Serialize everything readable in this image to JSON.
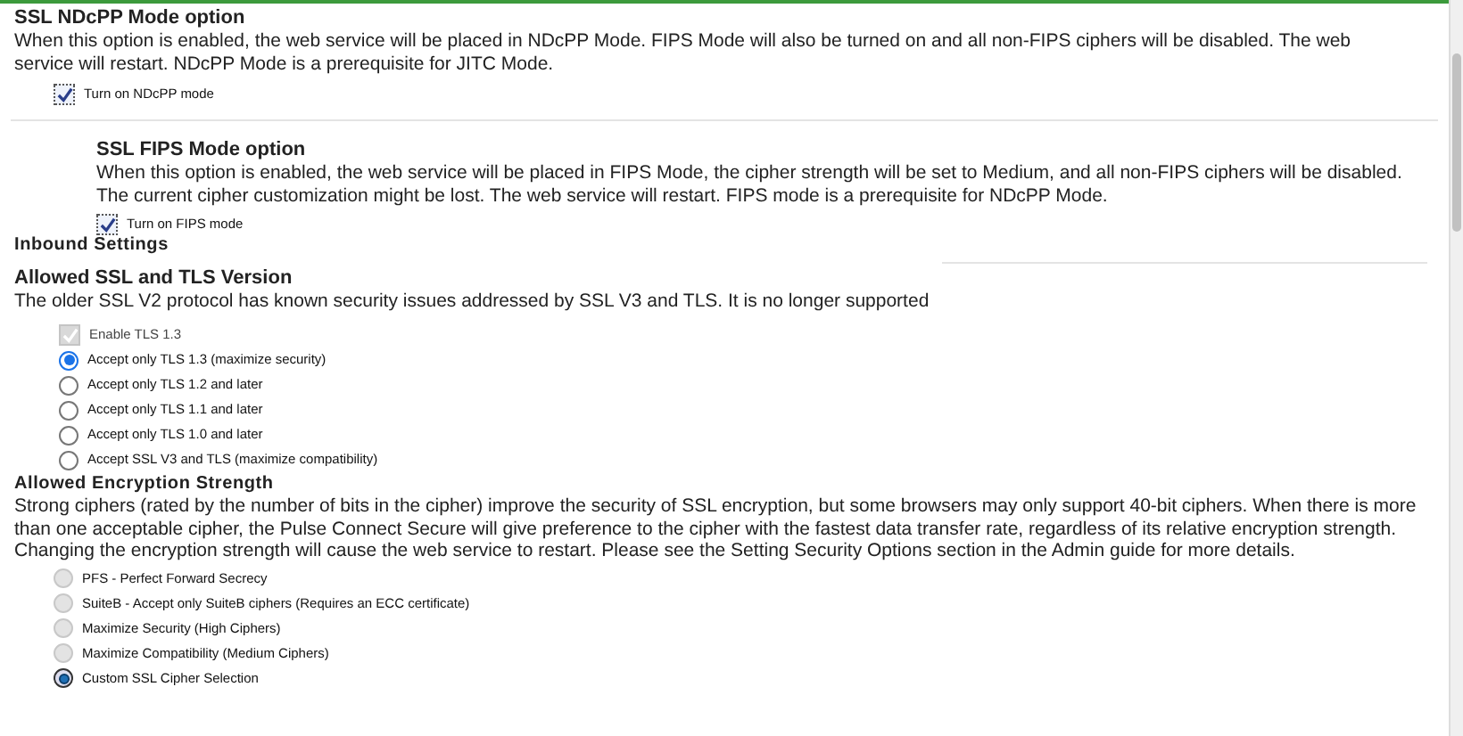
{
  "ndcpp": {
    "title": "SSL NDcPP Mode option",
    "description": "When this option is enabled, the web service will be placed in NDcPP Mode. FIPS Mode will also be turned on and all non-FIPS ciphers will be disabled. The web service will restart. NDcPP Mode is a prerequisite for JITC Mode.",
    "checkbox": {
      "label": "Turn on NDcPP mode",
      "checked": true
    }
  },
  "fips": {
    "title": "SSL FIPS Mode option",
    "description": "When this option is enabled, the web service will be placed in FIPS Mode, the cipher strength will be set to Medium, and all non-FIPS ciphers will be disabled. The current cipher customization might be lost. The web service will restart. FIPS mode is a prerequisite for NDcPP Mode.",
    "checkbox": {
      "label": "Turn on FIPS mode",
      "checked": true
    }
  },
  "inbound_title": "Inbound Settings",
  "tls": {
    "title": "Allowed SSL and TLS Version",
    "description": "The older SSL V2 protocol has known security issues addressed by SSL V3 and TLS. It is no longer supported",
    "enable_tls13": {
      "label": "Enable TLS 1.3",
      "checked": true,
      "disabled": true
    },
    "options": [
      {
        "label": "Accept only TLS 1.3 (maximize security)",
        "selected": true
      },
      {
        "label": "Accept only TLS 1.2 and later",
        "selected": false
      },
      {
        "label": "Accept only TLS 1.1 and later",
        "selected": false
      },
      {
        "label": "Accept only TLS 1.0 and later",
        "selected": false
      },
      {
        "label": "Accept SSL V3 and TLS (maximize compatibility)",
        "selected": false
      }
    ]
  },
  "encryption": {
    "title": "Allowed Encryption Strength",
    "description": "Strong ciphers (rated by the number of bits in the cipher) improve the security of SSL encryption, but some browsers may only support 40-bit ciphers. When there is more than one acceptable cipher, the Pulse Connect Secure will give preference to the cipher with the fastest data transfer rate, regardless of its relative encryption strength. Changing the encryption strength will cause the web service to restart. Please see the Setting Security Options section in the Admin guide for more details.",
    "options": [
      {
        "label": "PFS - Perfect Forward Secrecy",
        "selected": false
      },
      {
        "label": "SuiteB - Accept only SuiteB ciphers (Requires an ECC certificate)",
        "selected": false
      },
      {
        "label": "Maximize Security (High Ciphers)",
        "selected": false
      },
      {
        "label": "Maximize Compatibility (Medium Ciphers)",
        "selected": false
      },
      {
        "label": "Custom SSL Cipher Selection",
        "selected": true
      }
    ]
  }
}
